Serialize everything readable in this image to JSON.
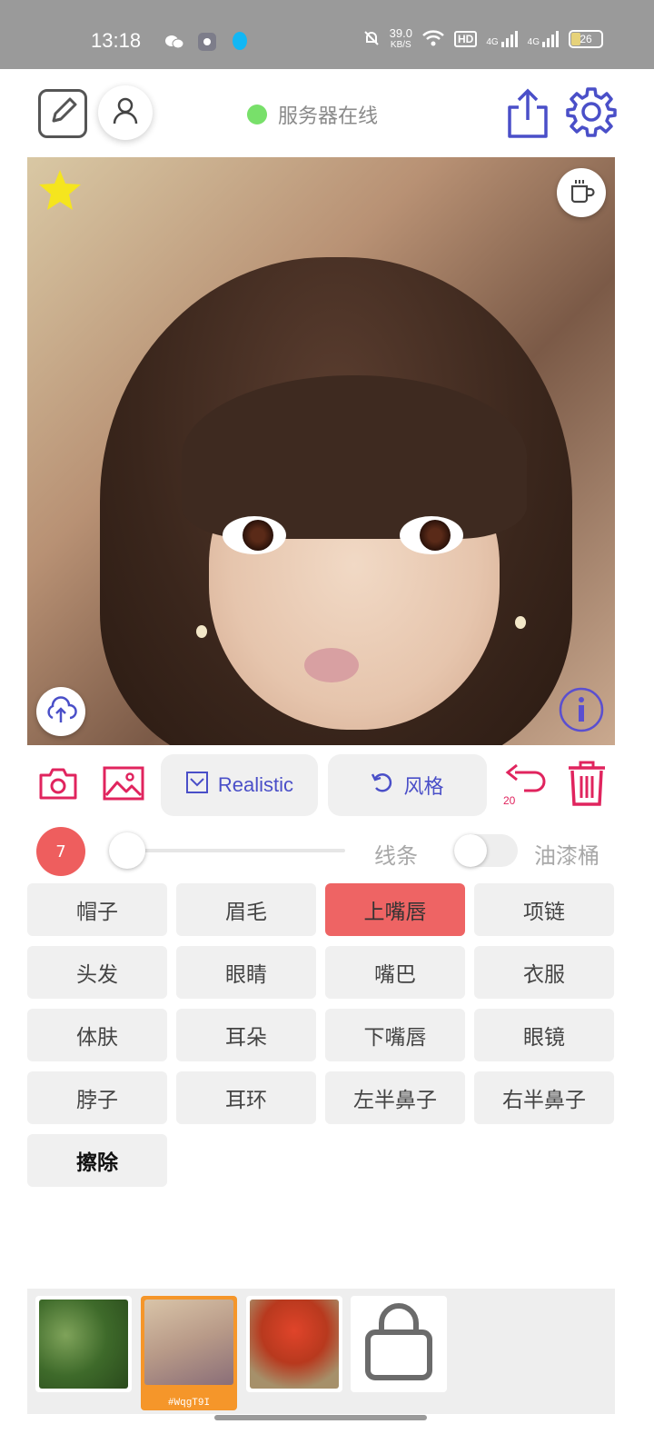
{
  "status_bar": {
    "time": "13:18",
    "net_speed_value": "39.0",
    "net_speed_unit": "KB/S",
    "hd_label": "HD",
    "sim1_label": "4G",
    "sim2_label": "4G",
    "battery": "26"
  },
  "header": {
    "server_status": "服务器在线",
    "status_color": "#78e06a"
  },
  "toolbar": {
    "style_mode_label": "Realistic",
    "style_label": "风格",
    "undo_count": "20",
    "accent_color": "#e0245e",
    "pill_text_color": "#4a4fc8"
  },
  "brush": {
    "size": "7",
    "slider_fraction": 0.0,
    "line_label": "线条",
    "bucket_label": "油漆桶",
    "bucket_enabled": false
  },
  "parts": [
    {
      "label": "帽子",
      "active": false
    },
    {
      "label": "眉毛",
      "active": false
    },
    {
      "label": "上嘴唇",
      "active": true
    },
    {
      "label": "项链",
      "active": false
    },
    {
      "label": "头发",
      "active": false
    },
    {
      "label": "眼睛",
      "active": false
    },
    {
      "label": "嘴巴",
      "active": false
    },
    {
      "label": "衣服",
      "active": false
    },
    {
      "label": "体肤",
      "active": false
    },
    {
      "label": "耳朵",
      "active": false
    },
    {
      "label": "下嘴唇",
      "active": false
    },
    {
      "label": "眼镜",
      "active": false
    },
    {
      "label": "脖子",
      "active": false
    },
    {
      "label": "耳环",
      "active": false
    },
    {
      "label": "左半鼻子",
      "active": false
    },
    {
      "label": "右半鼻子",
      "active": false
    },
    {
      "label": "擦除",
      "active": false
    }
  ],
  "gallery": {
    "items": [
      {
        "icon": "green-foliage-thumbnail",
        "caption": ""
      },
      {
        "icon": "portrait-thumbnail",
        "caption": "#WqgT9I"
      },
      {
        "icon": "red-tree-thumbnail",
        "caption": ""
      }
    ],
    "shop_icon": "shopping-bag-icon"
  }
}
